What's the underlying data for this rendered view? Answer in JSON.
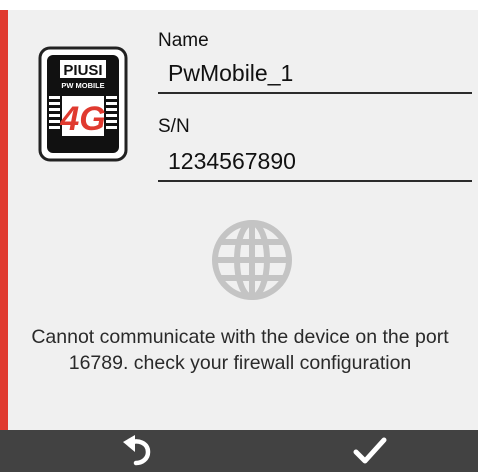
{
  "device": {
    "icon": "piusi-pw-mobile-4g-device-icon",
    "logo_text": "PIUSI",
    "model_text": "PW MOBILE",
    "network_text": "4G"
  },
  "fields": {
    "name_label": "Name",
    "name_value": "PwMobile_1",
    "sn_label": "S/N",
    "sn_value": "1234567890"
  },
  "status": {
    "icon": "globe-icon",
    "message": "Cannot communicate with the device on the port 16789. check your firewall configuration"
  },
  "toolbar": {
    "undo_icon": "undo-icon",
    "confirm_icon": "checkmark-icon"
  },
  "colors": {
    "accent": "#e03a2f",
    "background": "#f0f0f0",
    "toolbar": "#424242",
    "globe": "#c4c4c4"
  }
}
